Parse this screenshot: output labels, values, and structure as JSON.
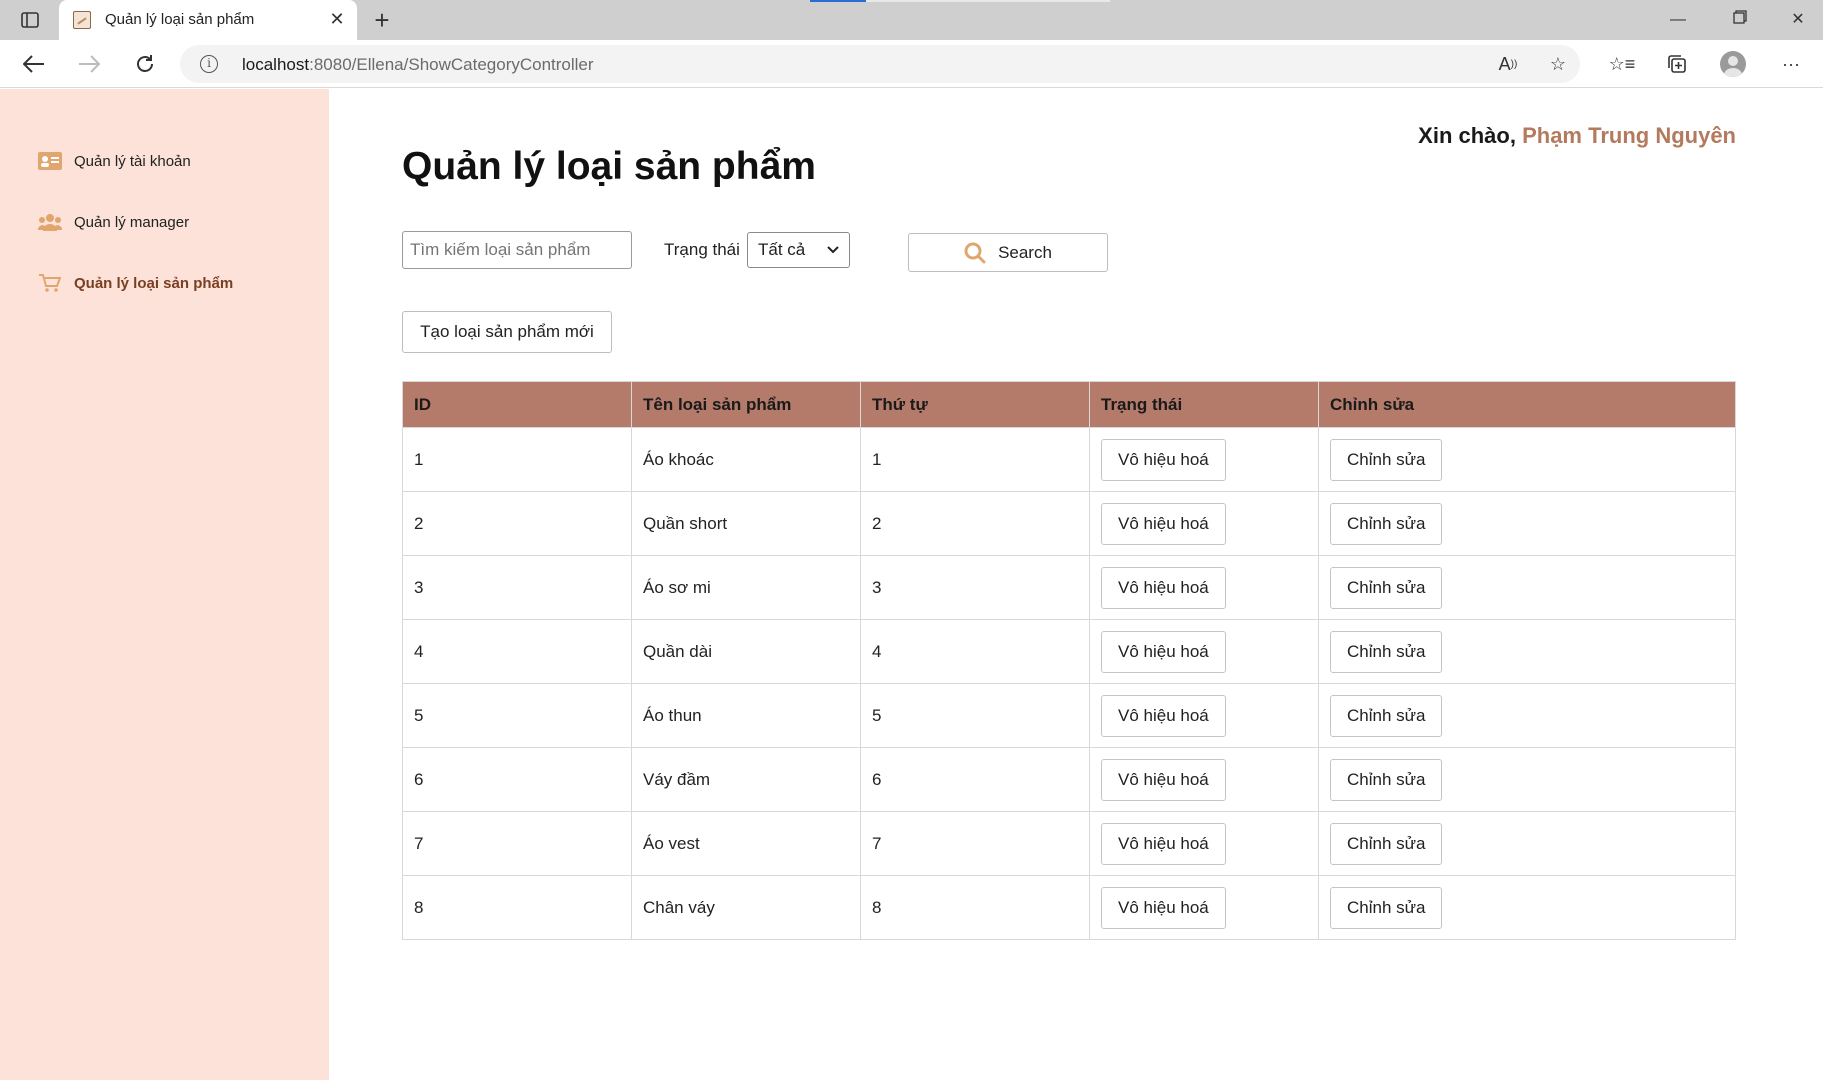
{
  "browser": {
    "tab_title": "Quản lý loại sản phẩm",
    "url_host": "localhost",
    "url_rest": ":8080/Ellena/ShowCategoryController"
  },
  "sidebar": {
    "items": [
      {
        "label": "Quản lý tài khoản",
        "icon": "id-card-icon",
        "active": false
      },
      {
        "label": "Quản lý manager",
        "icon": "users-icon",
        "active": false
      },
      {
        "label": "Quản lý loại sản phẩm",
        "icon": "cart-icon",
        "active": true
      }
    ]
  },
  "header": {
    "greeting_prefix": "Xin chào,",
    "user_name": "Phạm Trung Nguyên"
  },
  "page": {
    "title": "Quản lý loại sản phẩm"
  },
  "filters": {
    "search_placeholder": "Tìm kiếm loại sản phẩm",
    "status_label": "Trạng thái",
    "status_selected": "Tất cả",
    "search_button": "Search"
  },
  "actions": {
    "create_button": "Tạo loại sản phẩm mới"
  },
  "table": {
    "headers": [
      "ID",
      "Tên loại sản phẩm",
      "Thứ tự",
      "Trạng thái",
      "Chỉnh sửa"
    ],
    "rows": [
      {
        "id": "1",
        "name": "Áo khoác",
        "order": "1",
        "status_btn": "Vô hiệu hoá",
        "edit_btn": "Chỉnh sửa"
      },
      {
        "id": "2",
        "name": "Quần short",
        "order": "2",
        "status_btn": "Vô hiệu hoá",
        "edit_btn": "Chỉnh sửa"
      },
      {
        "id": "3",
        "name": "Áo sơ mi",
        "order": "3",
        "status_btn": "Vô hiệu hoá",
        "edit_btn": "Chỉnh sửa"
      },
      {
        "id": "4",
        "name": "Quần dài",
        "order": "4",
        "status_btn": "Vô hiệu hoá",
        "edit_btn": "Chỉnh sửa"
      },
      {
        "id": "5",
        "name": "Áo thun",
        "order": "5",
        "status_btn": "Vô hiệu hoá",
        "edit_btn": "Chỉnh sửa"
      },
      {
        "id": "6",
        "name": "Váy đầm",
        "order": "6",
        "status_btn": "Vô hiệu hoá",
        "edit_btn": "Chỉnh sửa"
      },
      {
        "id": "7",
        "name": "Áo vest",
        "order": "7",
        "status_btn": "Vô hiệu hoá",
        "edit_btn": "Chỉnh sửa"
      },
      {
        "id": "8",
        "name": "Chân váy",
        "order": "8",
        "status_btn": "Vô hiệu hoá",
        "edit_btn": "Chỉnh sửa"
      }
    ]
  },
  "colors": {
    "sidebar_bg": "#fce2d8",
    "table_header_bg": "#b47a6a",
    "accent_name": "#b47a5e",
    "sidebar_icon": "#e0a66e"
  }
}
